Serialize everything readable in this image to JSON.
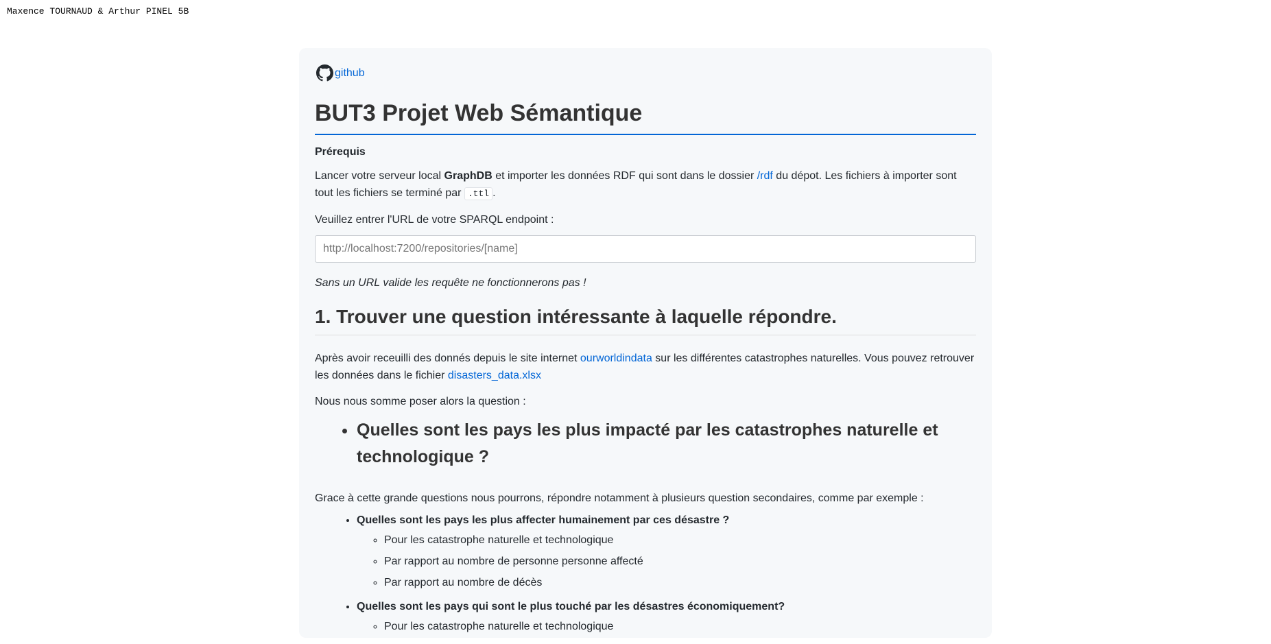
{
  "authors": "Maxence TOURNAUD & Arthur PINEL 5B",
  "github": {
    "label": "github",
    "icon": "github-icon"
  },
  "title": "BUT3 Projet Web Sémantique",
  "prereq": {
    "heading": "Prérequis",
    "text1": "Lancer votre serveur local ",
    "bold": "GraphDB",
    "text2": " et importer les données RDF qui sont dans le dossier ",
    "link": "/rdf",
    "text3": " du dépot. Les fichiers à importer sont tout les fichiers se terminé par ",
    "code": ".ttl",
    "text4": "."
  },
  "endpoint": {
    "label": "Veuillez entrer l'URL de votre SPARQL endpoint :",
    "placeholder": "http://localhost:7200/repositories/[name]",
    "warning": "Sans un URL valide les requête ne fonctionnerons pas !"
  },
  "section1": {
    "heading": "1. Trouver une question intéressante à laquelle répondre.",
    "p1_a": "Après avoir receuilli des donnés depuis le site internet ",
    "p1_link": "ourworldindata",
    "p1_b": " sur les différentes catastrophes naturelles. Vous pouvez retrouver les données dans le fichier ",
    "p1_link2": "disasters_data.xlsx",
    "p2": "Nous nous somme poser alors la question :",
    "main_question": "Quelles sont les pays les plus impacté par les catastrophes naturelle et technologique ?",
    "p3": "Grace à cette grande questions nous pourrons, répondre notamment à plusieurs question secondaires, comme par exemple :",
    "sub_questions": [
      {
        "q": "Quelles sont les pays les plus affecter humainement par ces désastre ?",
        "items": [
          "Pour les catastrophe naturelle et technologique",
          "Par rapport au nombre de personne personne affecté",
          "Par rapport au nombre de décès"
        ]
      },
      {
        "q": "Quelles sont les pays qui sont le plus touché par les désastres économiquement?",
        "items": [
          "Pour les catastrophe naturelle et technologique"
        ]
      }
    ]
  }
}
